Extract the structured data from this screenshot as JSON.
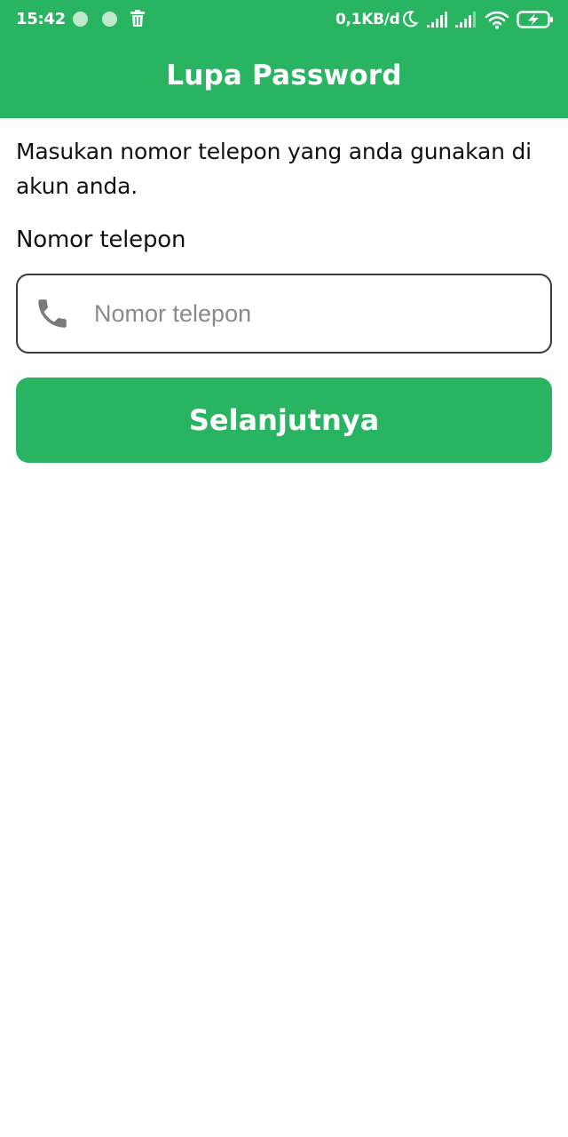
{
  "status_bar": {
    "time": "15:42",
    "network_speed": "0,1KB/d",
    "icons": [
      "notification-dot-icon",
      "notification-dot-icon",
      "trash-icon",
      "moon-icon",
      "signal-icon",
      "signal-icon",
      "wifi-icon",
      "battery-charging-icon"
    ]
  },
  "header": {
    "title": "Lupa Password"
  },
  "form": {
    "instruction": "Masukan nomor telepon yang anda gunakan di akun anda.",
    "phone_label": "Nomor telepon",
    "phone_placeholder": "Nomor telepon",
    "phone_value": "",
    "submit_label": "Selanjutnya"
  },
  "colors": {
    "primary": "#28b460",
    "text": "#111111",
    "placeholder": "#8a8a8a",
    "field_border": "#3a3a3a"
  }
}
